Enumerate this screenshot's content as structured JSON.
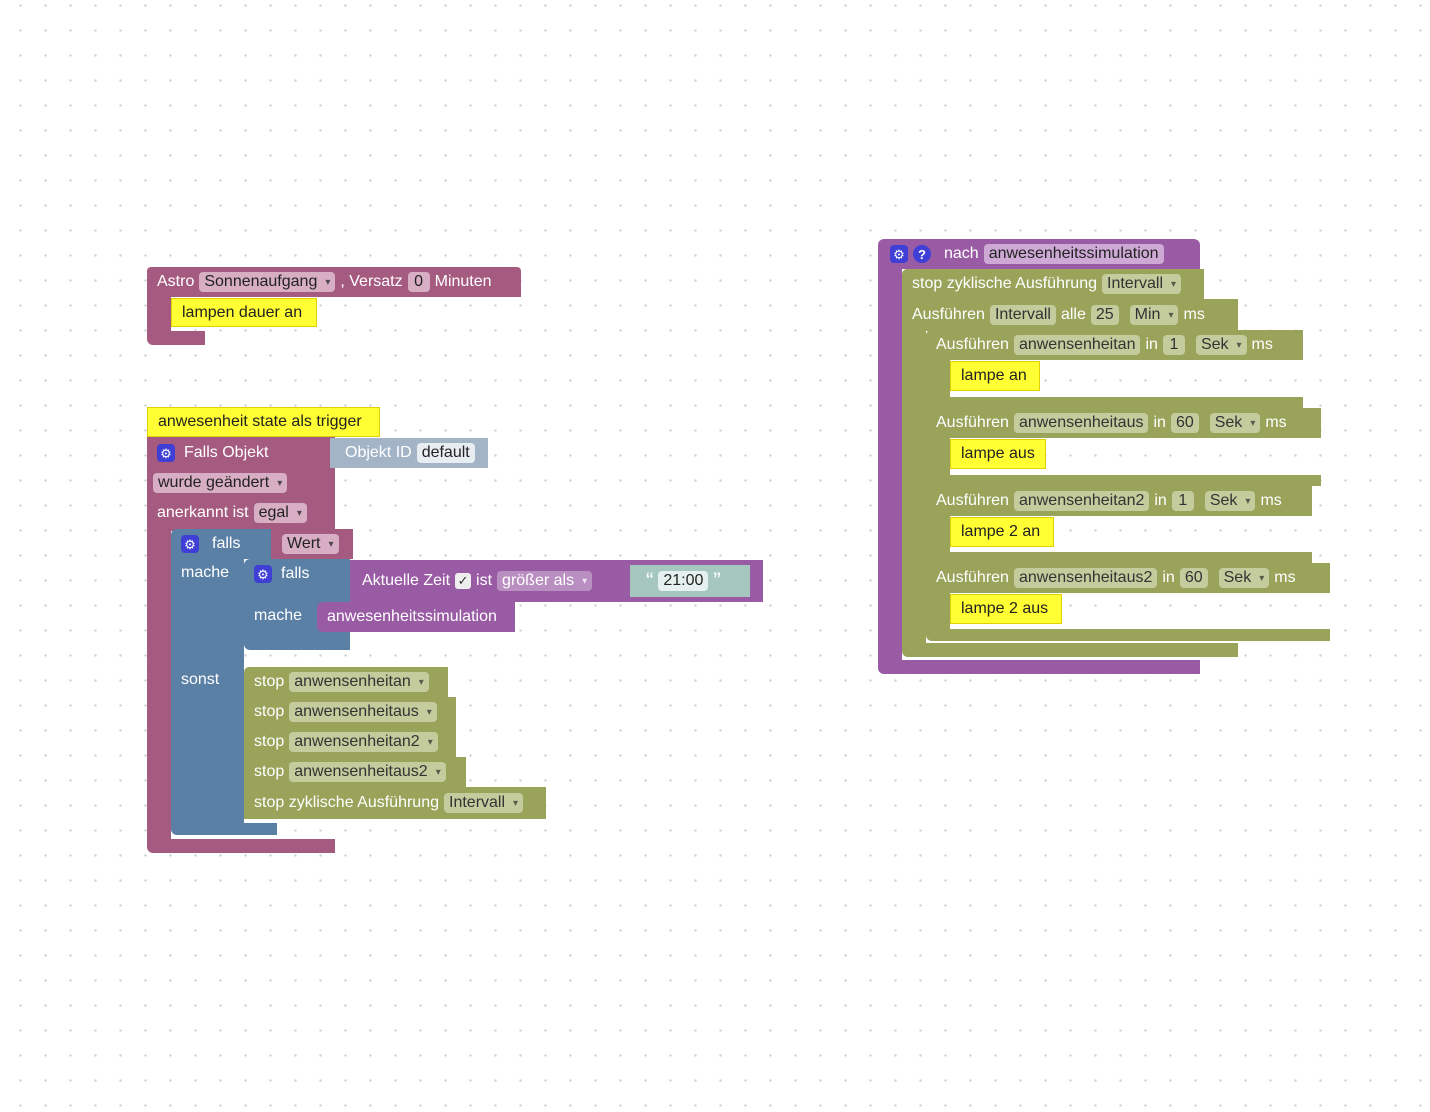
{
  "astro_block": {
    "label": "Astro",
    "event": "Sonnenaufgang",
    "offset_label": ", Versatz",
    "offset_value": "0",
    "unit": "Minuten",
    "comment": "lampen dauer an"
  },
  "trigger_block": {
    "comment": "anwesenheit state als trigger",
    "title": "Falls Objekt",
    "object_id_label": "Objekt ID",
    "object_id_value": "default",
    "changed": "wurde geändert",
    "ack_label": "anerkannt ist",
    "ack_value": "egal",
    "if_outer": {
      "falls_label": "falls",
      "condition": "Wert",
      "mache_label": "mache",
      "sonst_label": "sonst",
      "if_inner": {
        "falls_label": "falls",
        "mache_label": "mache",
        "compare": {
          "left": "Aktuelle Zeit",
          "check": "✓",
          "ist": "ist",
          "op": "größer als",
          "open_quote": "“",
          "value": "21:00",
          "close_quote": "”"
        },
        "call": "anwesenheitssimulation"
      },
      "stops": [
        {
          "label": "stop",
          "target": "anwensenheitan"
        },
        {
          "label": "stop",
          "target": "anwensenheitaus"
        },
        {
          "label": "stop",
          "target": "anwensenheitan2"
        },
        {
          "label": "stop",
          "target": "anwensenheitaus2"
        },
        {
          "label": "stop zyklische Ausführung",
          "target": "Intervall"
        }
      ]
    }
  },
  "function_block": {
    "gear": "⚙",
    "help": "?",
    "nach": "nach",
    "name": "anwesenheitssimulation",
    "stop_label": "stop zyklische Ausführung",
    "stop_target": "Intervall",
    "interval": {
      "label": "Ausführen",
      "name": "Intervall",
      "alle": "alle",
      "value": "25",
      "unit": "Min",
      "ms": "ms"
    },
    "timeouts": [
      {
        "label": "Ausführen",
        "name": "anwensenheitan",
        "in": "in",
        "value": "1",
        "unit": "Sek",
        "ms": "ms",
        "comment": "lampe an"
      },
      {
        "label": "Ausführen",
        "name": "anwensenheitaus",
        "in": "in",
        "value": "60",
        "unit": "Sek",
        "ms": "ms",
        "comment": "lampe aus"
      },
      {
        "label": "Ausführen",
        "name": "anwensenheitan2",
        "in": "in",
        "value": "1",
        "unit": "Sek",
        "ms": "ms",
        "comment": "lampe 2 an"
      },
      {
        "label": "Ausführen",
        "name": "anwensenheitaus2",
        "in": "in",
        "value": "60",
        "unit": "Sek",
        "ms": "ms",
        "comment": "lampe 2 aus"
      }
    ]
  }
}
